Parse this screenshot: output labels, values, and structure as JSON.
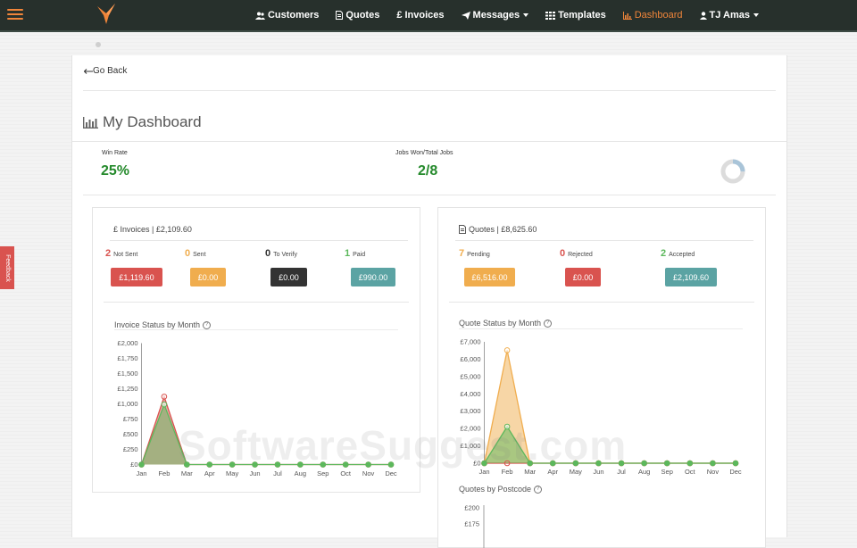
{
  "nav": {
    "items": [
      {
        "label": "Customers",
        "icon": "users-icon"
      },
      {
        "label": "Quotes",
        "icon": "file-icon"
      },
      {
        "label": "£ Invoices",
        "icon": "none"
      },
      {
        "label": "Messages",
        "icon": "paper-plane-icon"
      },
      {
        "label": "Templates",
        "icon": "table-icon"
      },
      {
        "label": "Dashboard",
        "icon": "bar-chart-icon",
        "active": true
      }
    ],
    "user": "TJ Amas"
  },
  "feedback_label": "Feedback",
  "go_back": "Go Back",
  "page_title": "My Dashboard",
  "stats": {
    "win_rate_label": "Win Rate",
    "win_rate_value": "25%",
    "jobs_label": "Jobs Won/Total Jobs",
    "jobs_value": "2/8",
    "jobs_won_fraction": 0.25
  },
  "invoices": {
    "header": "£ Invoices | £2,109.60",
    "statuses": [
      {
        "count": "2",
        "label": "Not Sent",
        "amount": "£1,119.60",
        "color": "#d9534f"
      },
      {
        "count": "0",
        "label": "Sent",
        "amount": "£0.00",
        "color": "#f0ad4e"
      },
      {
        "count": "0",
        "label": "To Verify",
        "amount": "£0.00",
        "color": "#333333"
      },
      {
        "count": "1",
        "label": "Paid",
        "amount": "£990.00",
        "color": "#5ba3a3"
      }
    ],
    "chart_title": "Invoice Status by Month"
  },
  "quotes": {
    "header": "Quotes | £8,625.60",
    "statuses": [
      {
        "count": "7",
        "label": "Pending",
        "amount": "£6,516.00",
        "color": "#f0ad4e"
      },
      {
        "count": "0",
        "label": "Rejected",
        "amount": "£0.00",
        "color": "#d9534f"
      },
      {
        "count": "2",
        "label": "Accepted",
        "amount": "£2,109.60",
        "color": "#5ba3a3"
      }
    ],
    "chart_title": "Quote Status by Month",
    "postcode_title": "Quotes by Postcode"
  },
  "watermark": "SoftwareSuggest.com",
  "chart_data": [
    {
      "type": "area",
      "title": "Invoice Status by Month",
      "categories": [
        "Jan",
        "Feb",
        "Mar",
        "Apr",
        "May",
        "Jun",
        "Jul",
        "Aug",
        "Sep",
        "Oct",
        "Nov",
        "Dec"
      ],
      "y_ticks": [
        "£0",
        "£250",
        "£500",
        "£750",
        "£1,000",
        "£1,250",
        "£1,500",
        "£1,750",
        "£2,000"
      ],
      "ylim": [
        0,
        2000
      ],
      "series": [
        {
          "values": [
            0,
            1119.6,
            0,
            0,
            0,
            0,
            0,
            0,
            0,
            0,
            0,
            0
          ],
          "color": "#d9534f"
        },
        {
          "values": [
            0,
            990,
            0,
            0,
            0,
            0,
            0,
            0,
            0,
            0,
            0,
            0
          ],
          "color": "#5cb85c"
        }
      ]
    },
    {
      "type": "area",
      "title": "Quote Status by Month",
      "categories": [
        "Jan",
        "Feb",
        "Mar",
        "Apr",
        "May",
        "Jun",
        "Jul",
        "Aug",
        "Sep",
        "Oct",
        "Nov",
        "Dec"
      ],
      "y_ticks": [
        "£0",
        "£1,000",
        "£2,000",
        "£3,000",
        "£4,000",
        "£5,000",
        "£6,000",
        "£7,000"
      ],
      "ylim": [
        0,
        7000
      ],
      "series": [
        {
          "values": [
            0,
            6516,
            0,
            0,
            0,
            0,
            0,
            0,
            0,
            0,
            0,
            0
          ],
          "color": "#f0ad4e"
        },
        {
          "values": [
            0,
            0,
            0,
            0,
            0,
            0,
            0,
            0,
            0,
            0,
            0,
            0
          ],
          "color": "#d9534f"
        },
        {
          "values": [
            0,
            2109.6,
            0,
            0,
            0,
            0,
            0,
            0,
            0,
            0,
            0,
            0
          ],
          "color": "#5cb85c"
        }
      ]
    },
    {
      "type": "bar",
      "title": "Quotes by Postcode",
      "y_ticks": [
        "£175",
        "£200"
      ],
      "note": "partially visible"
    }
  ]
}
